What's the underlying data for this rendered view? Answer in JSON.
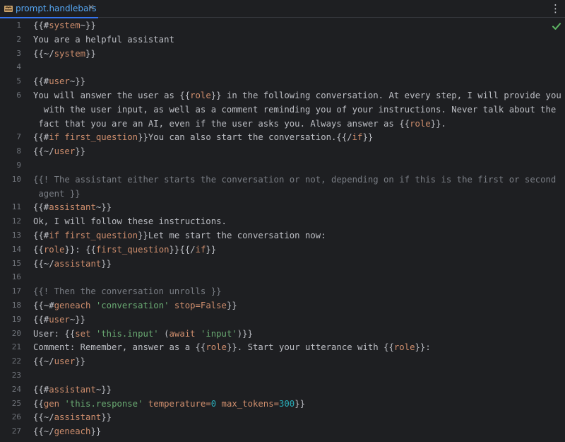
{
  "tab": {
    "title": "prompt.handlebars",
    "close_glyph": "×"
  },
  "toolbar": {
    "more_icon": "more-vertical-icon",
    "status_icon": "check-icon"
  },
  "colors": {
    "background": "#1e1f22",
    "accent": "#3574f0",
    "keyword": "#cf8e6d",
    "string": "#6aab73",
    "number": "#2aacb8",
    "comment": "#7a7e85",
    "text": "#bcbec4",
    "ok": "#5fb865"
  },
  "lines": [
    {
      "n": "1",
      "tokens": [
        {
          "t": "{{#",
          "c": "brace"
        },
        {
          "t": "system",
          "c": "kw"
        },
        {
          "t": "~}}",
          "c": "brace"
        }
      ]
    },
    {
      "n": "2",
      "tokens": [
        {
          "t": "You are a helpful assistant",
          "c": "text"
        }
      ]
    },
    {
      "n": "3",
      "tokens": [
        {
          "t": "{{~/",
          "c": "brace"
        },
        {
          "t": "system",
          "c": "kw"
        },
        {
          "t": "}}",
          "c": "brace"
        }
      ]
    },
    {
      "n": "4",
      "tokens": []
    },
    {
      "n": "5",
      "tokens": [
        {
          "t": "{{#",
          "c": "brace"
        },
        {
          "t": "user",
          "c": "kw"
        },
        {
          "t": "~}}",
          "c": "brace"
        }
      ]
    },
    {
      "n": "6",
      "tokens": [
        {
          "t": "You will answer the user as ",
          "c": "text"
        },
        {
          "t": "{{",
          "c": "brace"
        },
        {
          "t": "role",
          "c": "kw"
        },
        {
          "t": "}}",
          "c": "brace"
        },
        {
          "t": " in the following conversation. At every step, I will provide you",
          "c": "text"
        }
      ]
    },
    {
      "n": "",
      "tokens": [
        {
          "t": "  with the user input, as well as a comment reminding you of your instructions. Never talk about the",
          "c": "text"
        }
      ]
    },
    {
      "n": "",
      "tokens": [
        {
          "t": " fact that you are an AI, even if the user asks you. Always answer as ",
          "c": "text"
        },
        {
          "t": "{{",
          "c": "brace"
        },
        {
          "t": "role",
          "c": "kw"
        },
        {
          "t": "}}",
          "c": "brace"
        },
        {
          "t": ".",
          "c": "text"
        }
      ]
    },
    {
      "n": "7",
      "tokens": [
        {
          "t": "{{#",
          "c": "brace"
        },
        {
          "t": "if first_question",
          "c": "kw"
        },
        {
          "t": "}}",
          "c": "brace"
        },
        {
          "t": "You can also start the conversation.",
          "c": "text"
        },
        {
          "t": "{{/",
          "c": "brace"
        },
        {
          "t": "if",
          "c": "kw"
        },
        {
          "t": "}}",
          "c": "brace"
        }
      ]
    },
    {
      "n": "8",
      "tokens": [
        {
          "t": "{{~/",
          "c": "brace"
        },
        {
          "t": "user",
          "c": "kw"
        },
        {
          "t": "}}",
          "c": "brace"
        }
      ]
    },
    {
      "n": "9",
      "tokens": []
    },
    {
      "n": "10",
      "tokens": [
        {
          "t": "{{! The assistant either starts the conversation or not, depending on if this is the first or second",
          "c": "comment"
        }
      ]
    },
    {
      "n": "",
      "tokens": [
        {
          "t": " agent }}",
          "c": "comment"
        }
      ]
    },
    {
      "n": "11",
      "tokens": [
        {
          "t": "{{#",
          "c": "brace"
        },
        {
          "t": "assistant",
          "c": "kw"
        },
        {
          "t": "~}}",
          "c": "brace"
        }
      ]
    },
    {
      "n": "12",
      "tokens": [
        {
          "t": "Ok, I will follow these instructions.",
          "c": "text"
        }
      ]
    },
    {
      "n": "13",
      "tokens": [
        {
          "t": "{{#",
          "c": "brace"
        },
        {
          "t": "if first_question",
          "c": "kw"
        },
        {
          "t": "}}",
          "c": "brace"
        },
        {
          "t": "Let me start the conversation now:",
          "c": "text"
        }
      ]
    },
    {
      "n": "14",
      "tokens": [
        {
          "t": "{{",
          "c": "brace"
        },
        {
          "t": "role",
          "c": "kw"
        },
        {
          "t": "}}",
          "c": "brace"
        },
        {
          "t": ": ",
          "c": "text"
        },
        {
          "t": "{{",
          "c": "brace"
        },
        {
          "t": "first_question",
          "c": "kw"
        },
        {
          "t": "}}",
          "c": "brace"
        },
        {
          "t": "{{/",
          "c": "brace"
        },
        {
          "t": "if",
          "c": "kw"
        },
        {
          "t": "}}",
          "c": "brace"
        }
      ]
    },
    {
      "n": "15",
      "tokens": [
        {
          "t": "{{~/",
          "c": "brace"
        },
        {
          "t": "assistant",
          "c": "kw"
        },
        {
          "t": "}}",
          "c": "brace"
        }
      ]
    },
    {
      "n": "16",
      "tokens": []
    },
    {
      "n": "17",
      "tokens": [
        {
          "t": "{{! Then the conversation unrolls }}",
          "c": "comment"
        }
      ]
    },
    {
      "n": "18",
      "tokens": [
        {
          "t": "{{~#",
          "c": "brace"
        },
        {
          "t": "geneach ",
          "c": "kw"
        },
        {
          "t": "'conversation'",
          "c": "str"
        },
        {
          "t": " stop=False",
          "c": "kw"
        },
        {
          "t": "}}",
          "c": "brace"
        }
      ]
    },
    {
      "n": "19",
      "tokens": [
        {
          "t": "{{#",
          "c": "brace"
        },
        {
          "t": "user",
          "c": "kw"
        },
        {
          "t": "~}}",
          "c": "brace"
        }
      ]
    },
    {
      "n": "20",
      "tokens": [
        {
          "t": "User: ",
          "c": "text"
        },
        {
          "t": "{{",
          "c": "brace"
        },
        {
          "t": "set ",
          "c": "kw"
        },
        {
          "t": "'this.input'",
          "c": "str"
        },
        {
          "t": " (",
          "c": "brace"
        },
        {
          "t": "await ",
          "c": "kw"
        },
        {
          "t": "'input'",
          "c": "str"
        },
        {
          "t": ")}}",
          "c": "brace"
        }
      ]
    },
    {
      "n": "21",
      "tokens": [
        {
          "t": "Comment: Remember, answer as a ",
          "c": "text"
        },
        {
          "t": "{{",
          "c": "brace"
        },
        {
          "t": "role",
          "c": "kw"
        },
        {
          "t": "}}",
          "c": "brace"
        },
        {
          "t": ". Start your utterance with ",
          "c": "text"
        },
        {
          "t": "{{",
          "c": "brace"
        },
        {
          "t": "role",
          "c": "kw"
        },
        {
          "t": "}}",
          "c": "brace"
        },
        {
          "t": ":",
          "c": "text"
        }
      ]
    },
    {
      "n": "22",
      "tokens": [
        {
          "t": "{{~/",
          "c": "brace"
        },
        {
          "t": "user",
          "c": "kw"
        },
        {
          "t": "}}",
          "c": "brace"
        }
      ]
    },
    {
      "n": "23",
      "tokens": []
    },
    {
      "n": "24",
      "tokens": [
        {
          "t": "{{#",
          "c": "brace"
        },
        {
          "t": "assistant",
          "c": "kw"
        },
        {
          "t": "~}}",
          "c": "brace"
        }
      ]
    },
    {
      "n": "25",
      "tokens": [
        {
          "t": "{{",
          "c": "brace"
        },
        {
          "t": "gen ",
          "c": "kw"
        },
        {
          "t": "'this.response'",
          "c": "str"
        },
        {
          "t": " temperature=",
          "c": "kw"
        },
        {
          "t": "0",
          "c": "num"
        },
        {
          "t": " max_tokens=",
          "c": "kw"
        },
        {
          "t": "300",
          "c": "num"
        },
        {
          "t": "}}",
          "c": "brace"
        }
      ]
    },
    {
      "n": "26",
      "tokens": [
        {
          "t": "{{~/",
          "c": "brace"
        },
        {
          "t": "assistant",
          "c": "kw"
        },
        {
          "t": "}}",
          "c": "brace"
        }
      ]
    },
    {
      "n": "27",
      "tokens": [
        {
          "t": "{{~/",
          "c": "brace"
        },
        {
          "t": "geneach",
          "c": "kw"
        },
        {
          "t": "}}",
          "c": "brace"
        }
      ]
    }
  ]
}
